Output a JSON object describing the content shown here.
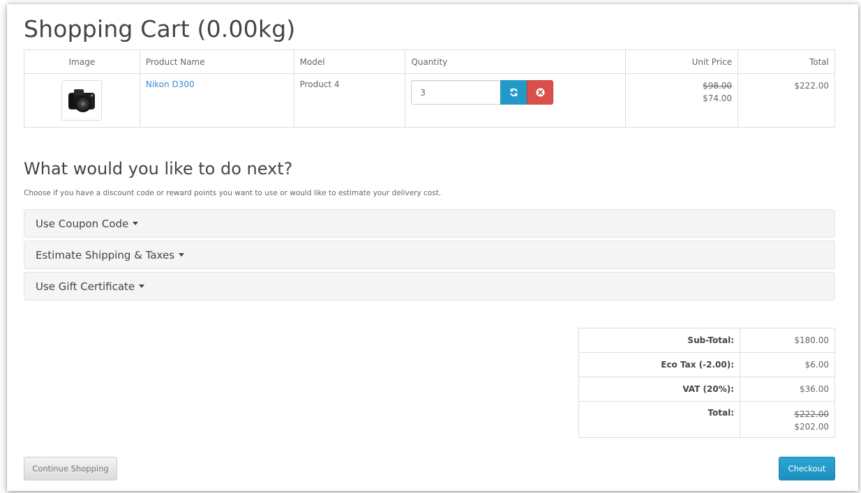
{
  "page": {
    "title": "Shopping Cart  (0.00kg)"
  },
  "cart": {
    "headers": {
      "image": "Image",
      "name": "Product Name",
      "model": "Model",
      "quantity": "Quantity",
      "unit_price": "Unit Price",
      "total": "Total"
    },
    "rows": [
      {
        "image_alt": "camera-image",
        "name": "Nikon D300",
        "model": "Product 4",
        "quantity": "3",
        "unit_price_old": "$98.00",
        "unit_price": "$74.00",
        "total": "$222.00"
      }
    ]
  },
  "next": {
    "title": "What would you like to do next?",
    "description": "Choose if you have a discount code or reward points you want to use or would like to estimate your delivery cost.",
    "panels": [
      "Use Coupon Code",
      "Estimate Shipping & Taxes",
      "Use Gift Certificate"
    ]
  },
  "totals": {
    "subtotal_label": "Sub-Total:",
    "subtotal_value": "$180.00",
    "ecotax_label": "Eco Tax (-2.00):",
    "ecotax_value": "$6.00",
    "vat_label": "VAT (20%):",
    "vat_value": "$36.00",
    "total_label": "Total:",
    "total_old": "$222.00",
    "total_value": "$202.00"
  },
  "buttons": {
    "continue": "Continue Shopping",
    "checkout": "Checkout"
  },
  "colors": {
    "link": "#3a8dd1",
    "update_button": "#229ac8",
    "remove_button": "#da4f49",
    "checkout_button": "#229ac8"
  },
  "icons": {
    "update": "refresh-icon",
    "remove": "remove-circle-icon",
    "panel_toggle": "caret-down-icon"
  }
}
